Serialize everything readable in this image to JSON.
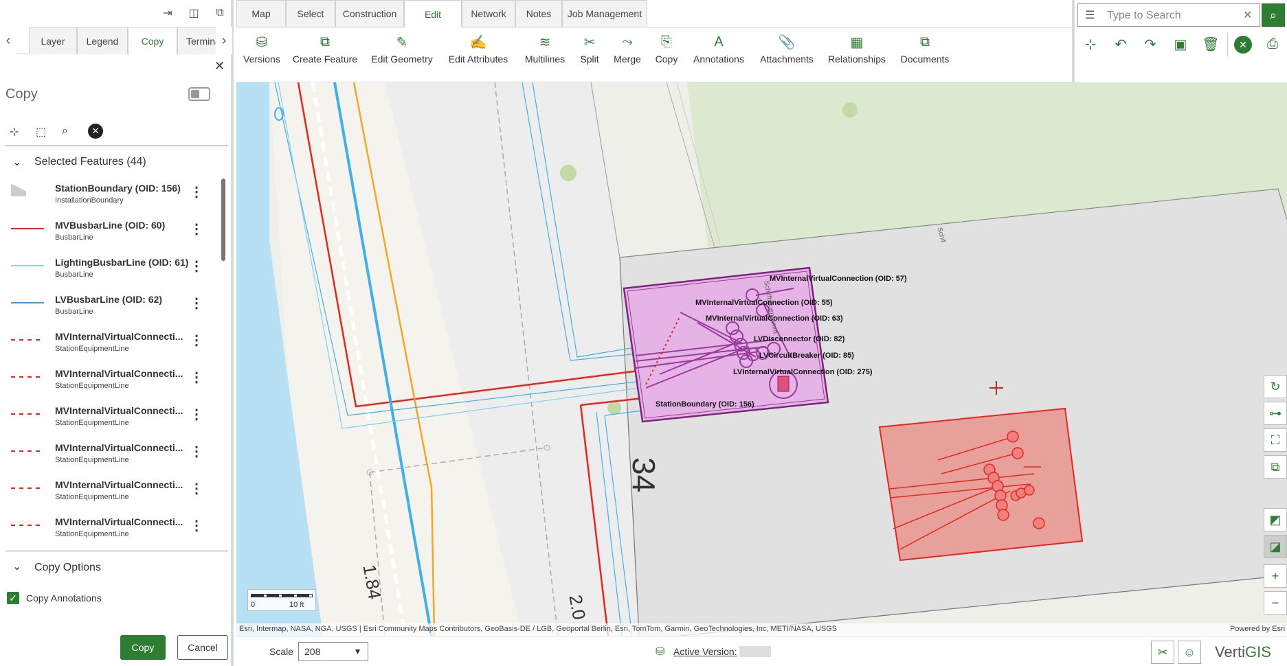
{
  "panel": {
    "tabs": [
      "Layer",
      "Legend",
      "Copy",
      "Termina"
    ],
    "title": "Copy",
    "selected_header": "Selected Features (44)",
    "features": [
      {
        "name": "StationBoundary (OID: 156)",
        "type": "InstallationBoundary",
        "symbol": "polygon-gray"
      },
      {
        "name": "MVBusbarLine (OID: 60)",
        "type": "BusbarLine",
        "symbol": "line-red"
      },
      {
        "name": "LightingBusbarLine (OID: 61)",
        "type": "BusbarLine",
        "symbol": "line-lightblue"
      },
      {
        "name": "LVBusbarLine (OID: 62)",
        "type": "BusbarLine",
        "symbol": "line-blue"
      },
      {
        "name": "MVInternalVirtualConnecti...",
        "type": "StationEquipmentLine",
        "symbol": "line-dashed-red"
      },
      {
        "name": "MVInternalVirtualConnecti...",
        "type": "StationEquipmentLine",
        "symbol": "line-dashed-red"
      },
      {
        "name": "MVInternalVirtualConnecti...",
        "type": "StationEquipmentLine",
        "symbol": "line-dashed-red"
      },
      {
        "name": "MVInternalVirtualConnecti...",
        "type": "StationEquipmentLine",
        "symbol": "line-dashed-red"
      },
      {
        "name": "MVInternalVirtualConnecti...",
        "type": "StationEquipmentLine",
        "symbol": "line-dashed-red"
      },
      {
        "name": "MVInternalVirtualConnecti...",
        "type": "StationEquipmentLine",
        "symbol": "line-dashed-red"
      }
    ],
    "options_header": "Copy Options",
    "copy_annotations_label": "Copy Annotations",
    "copy_annotations_checked": true,
    "copy_button": "Copy",
    "cancel_button": "Cancel"
  },
  "ribbon": {
    "tabs": [
      "Map",
      "Select",
      "Construction",
      "Edit",
      "Network",
      "Notes",
      "Job Management"
    ],
    "active_tab": "Edit",
    "tools": [
      "Versions",
      "Create Feature",
      "Edit Geometry",
      "Edit Attributes",
      "Multilines",
      "Split",
      "Merge",
      "Copy",
      "Annotations",
      "Attachments",
      "Relationships",
      "Documents"
    ]
  },
  "search": {
    "placeholder": "Type to Search"
  },
  "map": {
    "labels": {
      "l57": "MVInternalVirtualConnection (OID: 57)",
      "l55": "MVInternalVirtualConnection (OID: 55)",
      "l63": "MVInternalVirtualConnection (OID: 63)",
      "l82": "LVDisconnector (OID: 82)",
      "l85": "LVCircuitBreaker (OID: 85)",
      "l275": "LVInternalVirtualConnection (OID: 275)",
      "l156": "StationBoundary (OID: 156)"
    },
    "parcel_number": "34",
    "dim_1": "1.84",
    "dim_2": "2.0",
    "street": "Schiffbauerdamm",
    "street_short": "Schif",
    "scalebar_min": "0",
    "scalebar_max": "10 ft",
    "attribution": "Esri, Intermap, NASA, NGA, USGS | Esri Community Maps Contributors, GeoBasis-DE / LGB, Geoportal Berlin, Esri, TomTom, Garmin, GeoTechnologies, Inc, METI/NASA, USGS",
    "powered_by": "Powered by Esri"
  },
  "footer": {
    "scale_label": "Scale",
    "scale_value": "208",
    "active_version_label": "Active Version:",
    "brand": "VertiGIS"
  },
  "colors": {
    "accent": "#2e7d32",
    "selection": "#e6b3e6",
    "red_poly": "#e8a09a"
  }
}
